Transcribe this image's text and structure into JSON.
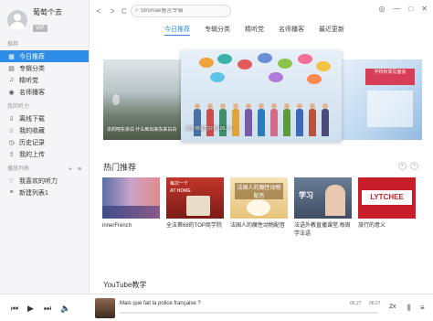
{
  "profile": {
    "username": "葡萄个去",
    "badge": "VIP"
  },
  "sidebar": {
    "section_recommend": "推荐",
    "recommend_items": [
      {
        "label": "今日推荐",
        "icon": "calendar-icon",
        "active": true
      },
      {
        "label": "专辑分类",
        "icon": "album-icon"
      },
      {
        "label": "精听党",
        "icon": "headphones-icon"
      },
      {
        "label": "名师播客",
        "icon": "podcast-icon"
      }
    ],
    "section_mine": "我的听力",
    "mine_items": [
      {
        "label": "离线下载",
        "icon": "download-icon"
      },
      {
        "label": "我的收藏",
        "icon": "star-icon"
      },
      {
        "label": "历史记录",
        "icon": "history-icon"
      },
      {
        "label": "我的上传",
        "icon": "upload-icon"
      }
    ],
    "section_playlists": "播放列表",
    "playlist_actions": "+ ≡",
    "playlist_items": [
      {
        "label": "我喜欢的听力",
        "icon": "heart-icon"
      },
      {
        "label": "新建列表1",
        "icon": "list-icon"
      }
    ]
  },
  "topbar": {
    "back": "<",
    "forward": ">",
    "refresh": "C",
    "search_placeholder": "Stromae留言专辑",
    "window_controls": [
      "◎",
      "—",
      "□",
      "✕"
    ]
  },
  "tabs": [
    "今日推荐",
    "专辑分类",
    "精听党",
    "名师播客",
    "最近更新"
  ],
  "carousel": {
    "left_caption": "伞的吧东京白 什么到出来东来白白",
    "center_caption": "如果地球村只有100人？",
    "center_poster": "学校秋季见面会",
    "right_caption": ""
  },
  "hot": {
    "title": "热门推荐",
    "nav": [
      "<",
      ">"
    ],
    "cards": [
      {
        "label": "innerFrench"
      },
      {
        "label": "全法第68的TOP商学院"
      },
      {
        "label": "法国人的魔性动物配音"
      },
      {
        "label": "法语外教直播课堂,每周学法语"
      },
      {
        "label": "旅行的意义"
      }
    ],
    "thumb_texts": {
      "card2_top": "每次一个",
      "card2_badge": "AT HOME",
      "card3_title": "法国人的魔性动物配音",
      "card4_title": "学习",
      "card5_logo": "LYTCHEE"
    }
  },
  "youtube_section": "YouTube教学",
  "player": {
    "prev": "⏮",
    "play": "▶",
    "next": "⏭",
    "volume": "🔈",
    "track_title": "Mais que fait la police française ?",
    "elapsed": "06:27",
    "total": "06:27",
    "speed": "2x",
    "progress": 0
  },
  "colors": {
    "accent": "#2e8de7",
    "sidebar_bg": "#f5f5f7"
  }
}
